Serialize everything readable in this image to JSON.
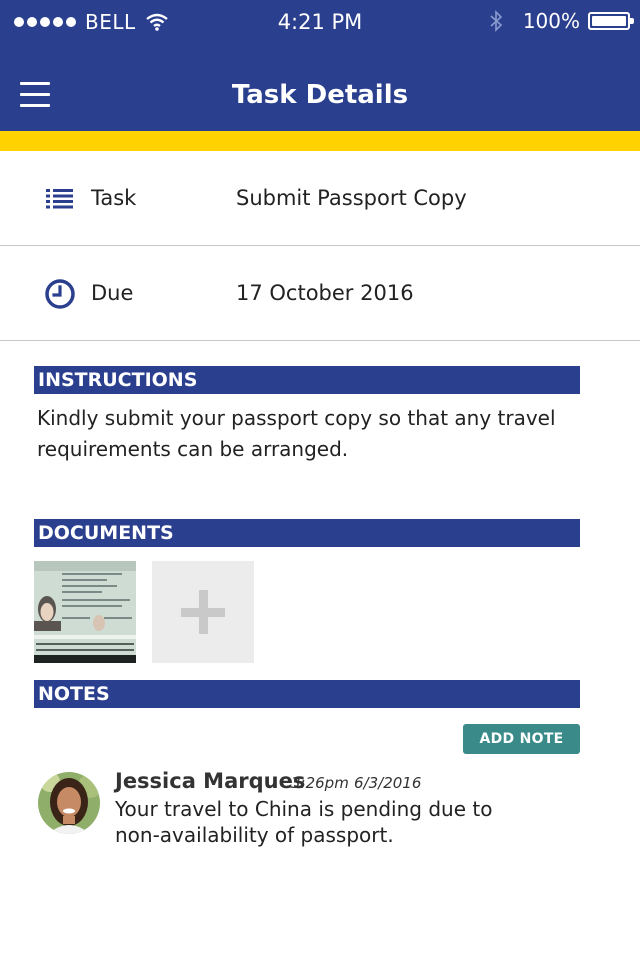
{
  "status_bar": {
    "carrier": "BELL",
    "time": "4:21 PM",
    "battery": "100%"
  },
  "nav": {
    "title": "Task Details"
  },
  "details": {
    "task_label": "Task",
    "task_value": "Submit Passport Copy",
    "due_label": "Due",
    "due_value": "17 October 2016"
  },
  "instructions": {
    "header": "INSTRUCTIONS",
    "text": "Kindly submit your passport copy so that any travel requirements can be arranged."
  },
  "documents": {
    "header": "DOCUMENTS"
  },
  "notes": {
    "header": "NOTES",
    "add_label": "ADD NOTE",
    "items": [
      {
        "author": "Jessica Marques",
        "time": "3:26pm",
        "date": "6/3/2016",
        "text": "Your travel to China is pending due to non-availability of passport."
      }
    ]
  },
  "colors": {
    "brand_blue": "#2b3f8f",
    "accent_yellow": "#ffd200",
    "button_teal": "#3b8a8a"
  }
}
